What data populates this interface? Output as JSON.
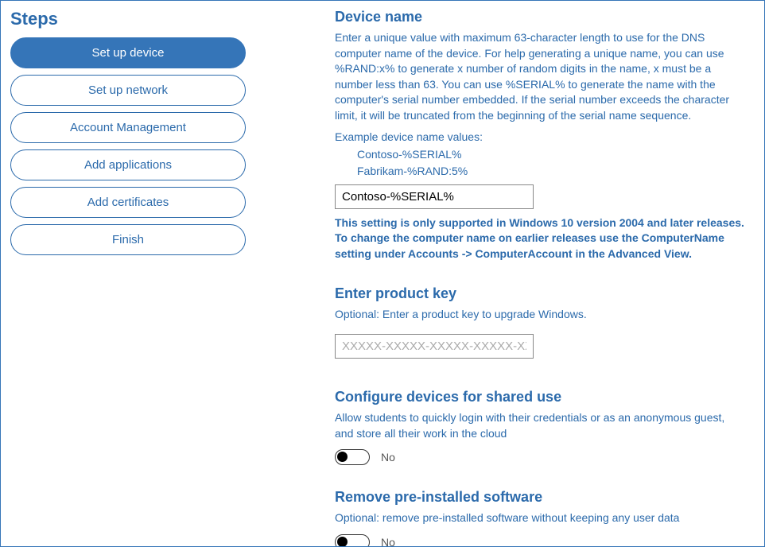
{
  "sidebar": {
    "title": "Steps",
    "items": [
      {
        "label": "Set up device",
        "active": true
      },
      {
        "label": "Set up network",
        "active": false
      },
      {
        "label": "Account Management",
        "active": false
      },
      {
        "label": "Add applications",
        "active": false
      },
      {
        "label": "Add certificates",
        "active": false
      },
      {
        "label": "Finish",
        "active": false
      }
    ]
  },
  "deviceName": {
    "title": "Device name",
    "description": "Enter a unique value with maximum 63-character length to use for the DNS computer name of the device. For help generating a unique name, you can use %RAND:x% to generate x number of random digits in the name, x must be a number less than 63. You can use %SERIAL% to generate the name with the computer's serial number embedded. If the serial number exceeds the character limit, it will be truncated from the beginning of the serial name sequence.",
    "exampleLabel": "Example device name values:",
    "examples": [
      "Contoso-%SERIAL%",
      "Fabrikam-%RAND:5%"
    ],
    "inputValue": "Contoso-%SERIAL%",
    "warning": "This setting is only supported in Windows 10 version 2004 and later releases. To change the computer name on earlier releases use the ComputerName setting under Accounts -> ComputerAccount in the Advanced View."
  },
  "productKey": {
    "title": "Enter product key",
    "description": "Optional: Enter a product key to upgrade Windows.",
    "placeholder": "XXXXX-XXXXX-XXXXX-XXXXX-XXXXX"
  },
  "sharedUse": {
    "title": "Configure devices for shared use",
    "description": "Allow students to quickly login with their credentials or as an anonymous guest, and store all their work in the cloud",
    "toggleValue": "No"
  },
  "removeSoftware": {
    "title": "Remove pre-installed software",
    "description": "Optional: remove pre-installed software without keeping any user data",
    "toggleValue": "No"
  }
}
